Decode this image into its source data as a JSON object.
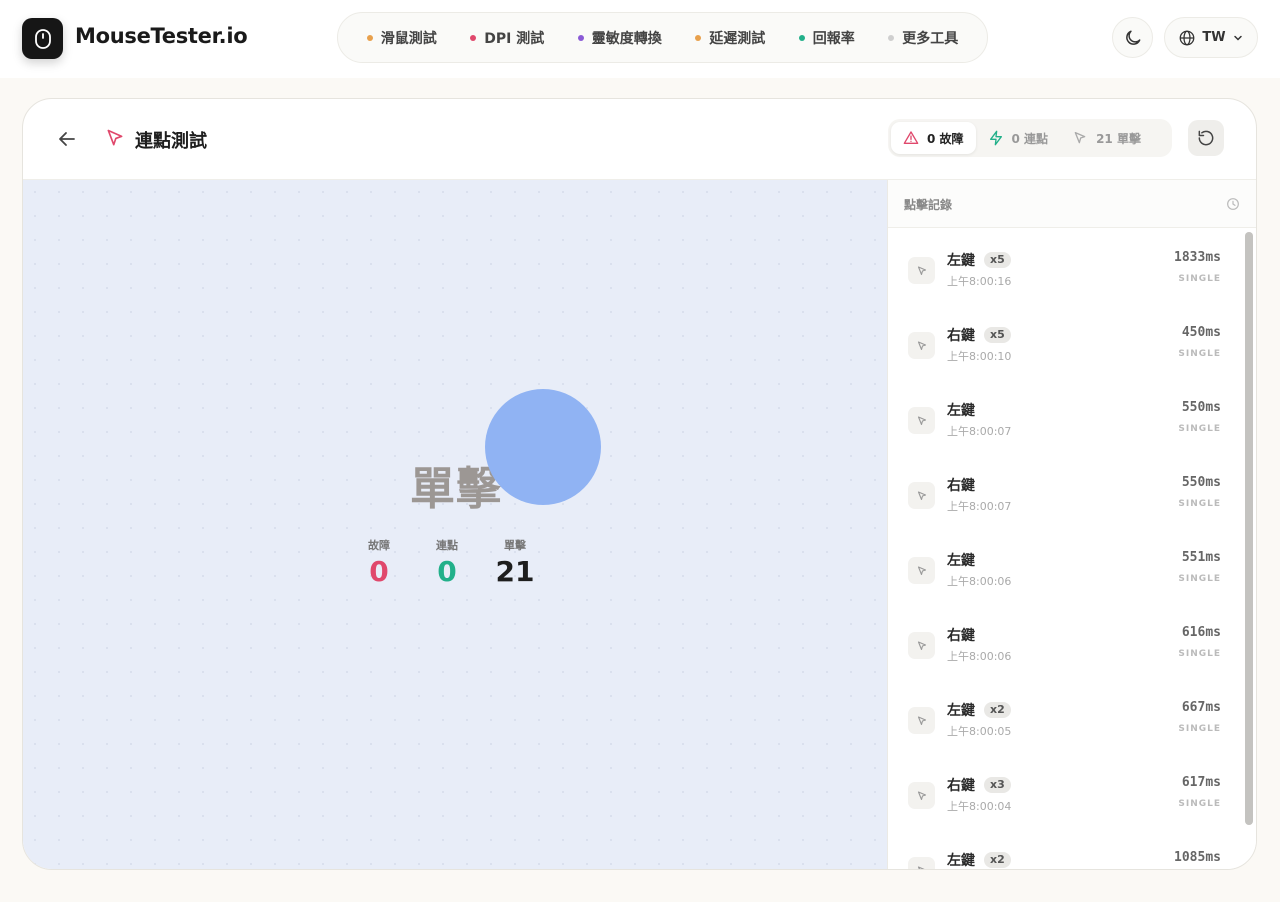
{
  "header": {
    "logo_text": "MouseTester.io",
    "nav": [
      {
        "label": "滑鼠測試",
        "dot": "#e8a04c"
      },
      {
        "label": "DPI 測試",
        "dot": "#e0486c"
      },
      {
        "label": "靈敏度轉換",
        "dot": "#8a5ad6"
      },
      {
        "label": "延遲測試",
        "dot": "#e8a04c"
      },
      {
        "label": "回報率",
        "dot": "#22b08a"
      },
      {
        "label": "更多工具",
        "dot": "#cfcfcf"
      }
    ],
    "lang": "TW"
  },
  "page": {
    "title": "連點測試",
    "stats": {
      "fault_label": "0 故障",
      "burst_label": "0 連點",
      "single_label": "21 單擊"
    }
  },
  "test_area": {
    "current_label": "單擊",
    "stats": [
      {
        "label": "故障",
        "value": "0",
        "color": "#e0486c"
      },
      {
        "label": "連點",
        "value": "0",
        "color": "#22b08a"
      },
      {
        "label": "單擊",
        "value": "21",
        "color": "#1e1e1e"
      }
    ]
  },
  "log": {
    "title": "點擊記錄",
    "entries": [
      {
        "button": "左鍵",
        "count": "x5",
        "time": "上午8:00:16",
        "ms": "1833ms",
        "type": "SINGLE"
      },
      {
        "button": "右鍵",
        "count": "x5",
        "time": "上午8:00:10",
        "ms": "450ms",
        "type": "SINGLE"
      },
      {
        "button": "左鍵",
        "count": "",
        "time": "上午8:00:07",
        "ms": "550ms",
        "type": "SINGLE"
      },
      {
        "button": "右鍵",
        "count": "",
        "time": "上午8:00:07",
        "ms": "550ms",
        "type": "SINGLE"
      },
      {
        "button": "左鍵",
        "count": "",
        "time": "上午8:00:06",
        "ms": "551ms",
        "type": "SINGLE"
      },
      {
        "button": "右鍵",
        "count": "",
        "time": "上午8:00:06",
        "ms": "616ms",
        "type": "SINGLE"
      },
      {
        "button": "左鍵",
        "count": "x2",
        "time": "上午8:00:05",
        "ms": "667ms",
        "type": "SINGLE"
      },
      {
        "button": "右鍵",
        "count": "x3",
        "time": "上午8:00:04",
        "ms": "617ms",
        "type": "SINGLE"
      },
      {
        "button": "左鍵",
        "count": "x2",
        "time": "",
        "ms": "1085ms",
        "type": ""
      }
    ]
  },
  "colors": {
    "accent_pink": "#e0486c",
    "accent_green": "#22b08a",
    "click_circle": "#90b3f3",
    "test_bg": "#e8edf8"
  }
}
